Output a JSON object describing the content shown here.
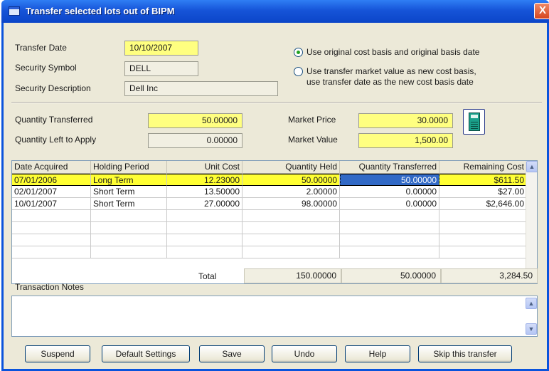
{
  "window": {
    "title": "Transfer selected lots out of BIPM",
    "close_glyph": "X"
  },
  "header": {
    "transfer_date_label": "Transfer Date",
    "transfer_date": "10/10/2007",
    "symbol_label": "Security Symbol",
    "symbol": "DELL",
    "description_label": "Security Description",
    "description": "Dell Inc"
  },
  "basis_options": [
    {
      "text": "Use original cost basis and original basis date",
      "checked": true
    },
    {
      "text": "Use transfer market value as new cost basis,\nuse transfer date as the new cost basis date",
      "checked": false
    }
  ],
  "quantities": {
    "qty_transferred_label": "Quantity Transferred",
    "qty_transferred": "50.00000",
    "qty_left_label": "Quantity Left to Apply",
    "qty_left": "0.00000",
    "market_price_label": "Market Price",
    "market_price": "30.0000",
    "market_value_label": "Market Value",
    "market_value": "1,500.00",
    "calculator_icon": "calculator-icon"
  },
  "lots": {
    "columns": [
      "Date Acquired",
      "Holding Period",
      "Unit Cost",
      "Quantity Held",
      "Quantity Transferred",
      "Remaining Cost"
    ],
    "rows": [
      [
        "07/01/2006",
        "Long Term",
        "12.23000",
        "50.00000",
        "50.00000",
        "$611.50"
      ],
      [
        "02/01/2007",
        "Short Term",
        "13.50000",
        "2.00000",
        "0.00000",
        "$27.00"
      ],
      [
        "10/01/2007",
        "Short Term",
        "27.00000",
        "98.00000",
        "0.00000",
        "$2,646.00"
      ]
    ],
    "selected_row": 0
  },
  "totals": {
    "label": "Total",
    "quantity_held": "150.00000",
    "quantity_transferred": "50.00000",
    "remaining_cost": "3,284.50"
  },
  "notes": {
    "label": "Transaction Notes",
    "value": ""
  },
  "buttons": {
    "suspend": "Suspend",
    "default_settings": "Default Settings",
    "save": "Save",
    "undo": "Undo",
    "help": "Help",
    "skip": "Skip this transfer"
  },
  "colors": {
    "highlight": "#ffff33",
    "input_yellow": "#ffff80",
    "title_blue": "#0b45c8",
    "selection_blue": "#3169c6"
  }
}
